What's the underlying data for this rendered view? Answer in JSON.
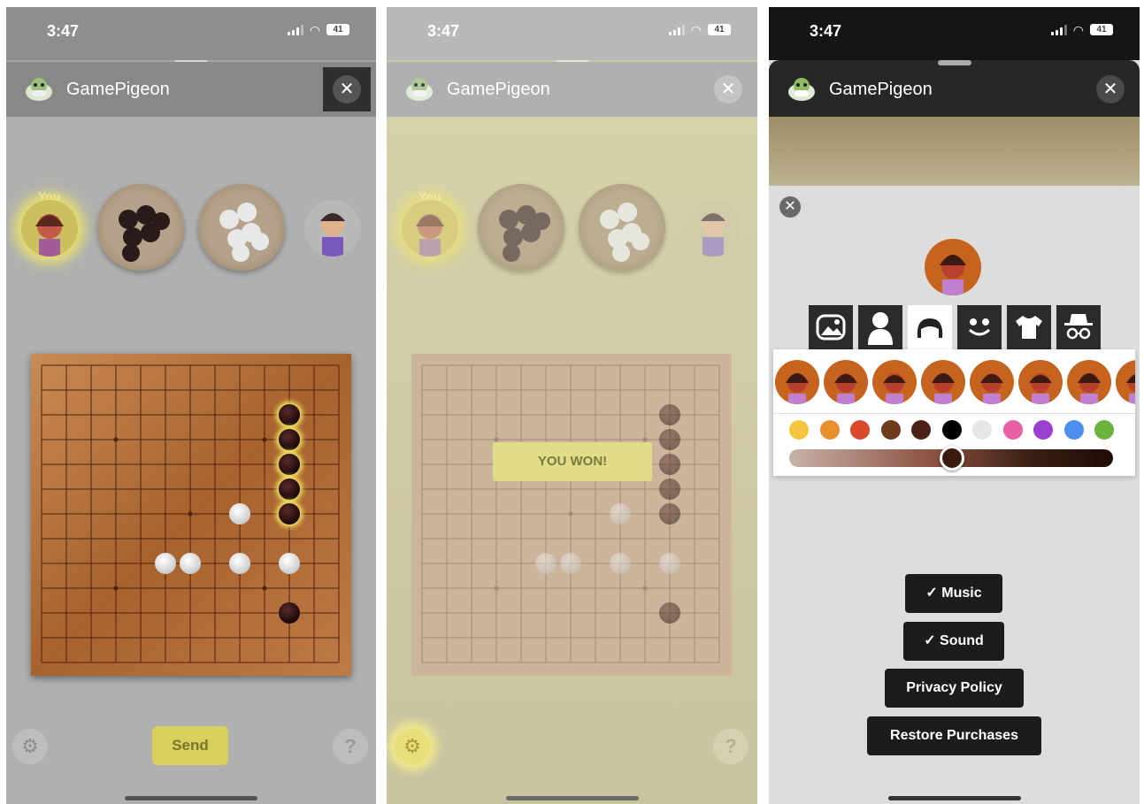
{
  "status_bar": {
    "time": "3:47",
    "battery": "41"
  },
  "header": {
    "app_title": "GamePigeon",
    "close_glyph": "✕"
  },
  "players": {
    "you_label": "You"
  },
  "game": {
    "send_label": "Send",
    "help_glyph": "?",
    "result_banner": "YOU WON!"
  },
  "settings": {
    "close_glyph": "✕",
    "tabs": [
      "background-icon",
      "body-icon",
      "hair-icon",
      "face-icon",
      "shirt-icon",
      "accessories-icon"
    ],
    "selected_tab": "hair-icon",
    "colors": [
      "#f5c542",
      "#e8902e",
      "#d94a2b",
      "#6e3a1c",
      "#4a2316",
      "#000000",
      "#e6e6e6",
      "#e85fa6",
      "#9b3fd1",
      "#4d8ef0",
      "#6bb33a"
    ],
    "skin_slider_value": 0.5,
    "music_label": "✓ Music",
    "sound_label": "✓ Sound",
    "privacy_label": "Privacy Policy",
    "restore_label": "Restore Purchases"
  }
}
